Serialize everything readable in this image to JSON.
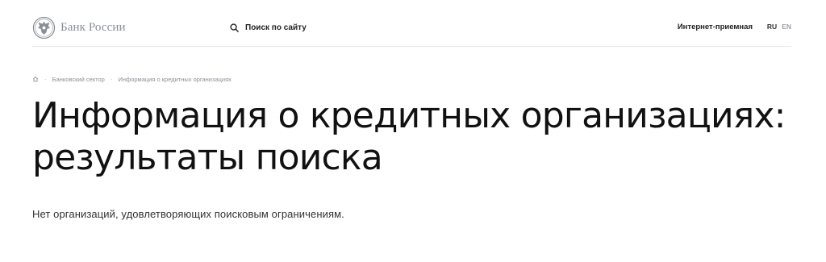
{
  "header": {
    "logo_text": "Банк России",
    "search_label": "Поиск по сайту",
    "reception_label": "Интернет-приемная",
    "languages": [
      "RU",
      "EN"
    ],
    "active_language": "RU"
  },
  "breadcrumb": {
    "items": [
      "Банковский сектор",
      "Информация о кредитных организациях"
    ]
  },
  "page": {
    "title": "Информация о кредитных организациях: результаты поиска",
    "message": "Нет организаций, удовлетворяющих поисковым ограничениям."
  },
  "colors": {
    "text": "#111111",
    "muted": "#8a8f98",
    "divider": "#e6e6e6"
  }
}
